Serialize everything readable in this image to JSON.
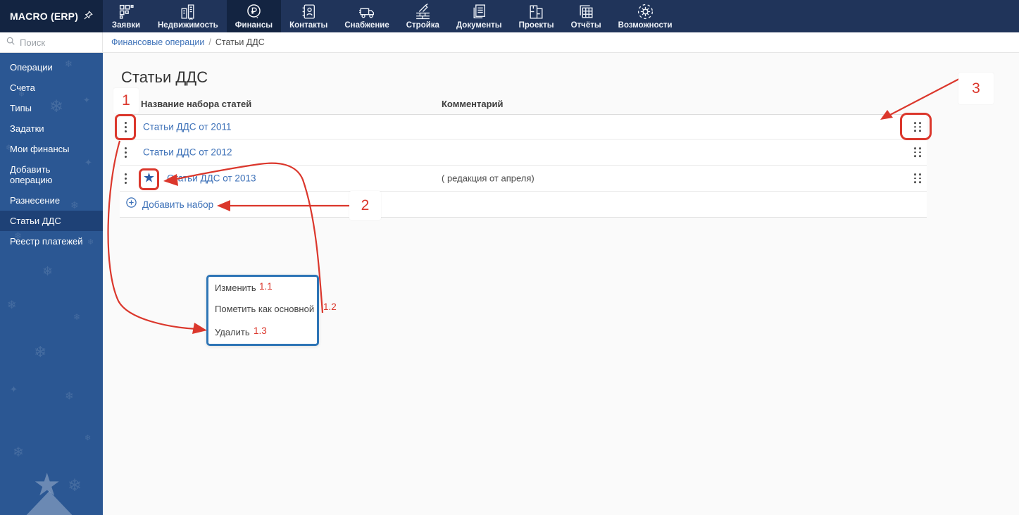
{
  "topbar": {
    "logo": "MACRO (ERP)",
    "nav": [
      {
        "label": "Заявки",
        "icon": "apps-grid-icon",
        "active": false
      },
      {
        "label": "Недвижимость",
        "icon": "buildings-icon",
        "active": false
      },
      {
        "label": "Финансы",
        "icon": "ruble-circle-icon",
        "active": true
      },
      {
        "label": "Контакты",
        "icon": "contacts-book-icon",
        "active": false
      },
      {
        "label": "Снабжение",
        "icon": "truck-icon",
        "active": false
      },
      {
        "label": "Стройка",
        "icon": "trowel-bricks-icon",
        "active": false
      },
      {
        "label": "Документы",
        "icon": "documents-icon",
        "active": false
      },
      {
        "label": "Проекты",
        "icon": "blueprint-icon",
        "active": false
      },
      {
        "label": "Отчёты",
        "icon": "report-sheets-icon",
        "active": false
      },
      {
        "label": "Возможности",
        "icon": "gear-dashed-icon",
        "active": false
      }
    ]
  },
  "search": {
    "placeholder": "Поиск"
  },
  "breadcrumb": {
    "parent": "Финансовые операции",
    "separator": "/",
    "current": "Статьи ДДС"
  },
  "sidebar": {
    "items": [
      {
        "label": "Операции"
      },
      {
        "label": "Счета"
      },
      {
        "label": "Типы"
      },
      {
        "label": "Задатки"
      },
      {
        "label": "Мои финансы"
      },
      {
        "label": "Добавить операцию"
      },
      {
        "label": "Разнесение"
      },
      {
        "label": "Статьи ДДС",
        "active": true
      },
      {
        "label": "Реестр платежей"
      }
    ]
  },
  "page": {
    "title": "Статьи ДДС"
  },
  "table": {
    "columns": {
      "name": "Название набора статей",
      "comment": "Комментарий"
    },
    "rows": [
      {
        "name": "Статьи ДДС от 2011",
        "comment": "",
        "starred": false
      },
      {
        "name": "Статьи ДДС от 2012",
        "comment": "",
        "starred": false
      },
      {
        "name": "Статьи ДДС от 2013",
        "comment": "( редакция от апреля)",
        "starred": true
      }
    ],
    "add_label": "Добавить набор"
  },
  "context_menu": {
    "items": [
      {
        "label": "Изменить",
        "badge": "1.1"
      },
      {
        "label": "Пометить как основной",
        "badge": "1.2"
      },
      {
        "label": "Удалить",
        "badge": "1.3"
      }
    ]
  },
  "annotations": {
    "labels": {
      "one": "1",
      "two": "2",
      "three": "3"
    }
  },
  "colors": {
    "annotation_red": "#db372c",
    "link_blue": "#3d71b8",
    "popup_border_blue": "#2e75b6",
    "star_blue": "#2d5ca6",
    "sidebar_blue": "#2b5793",
    "sidebar_active_blue": "#1e4176",
    "topbar_navy": "#20345a",
    "topbar_dark_navy": "#132441"
  }
}
